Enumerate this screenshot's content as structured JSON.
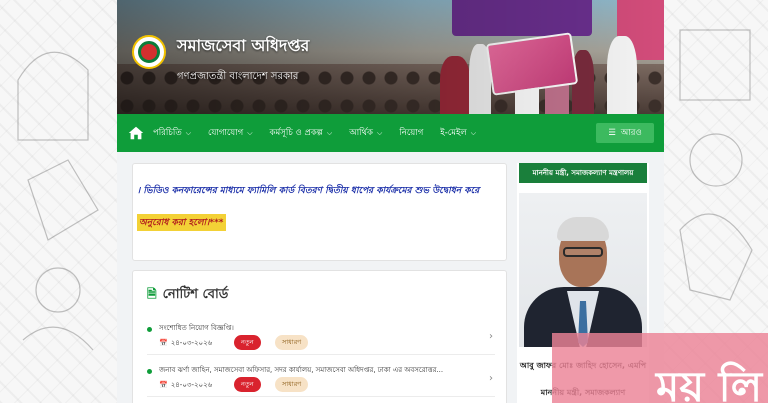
{
  "header": {
    "site_title": "সমাজসেবা অধিদপ্তর",
    "site_subtitle": "গণপ্রজাতন্ত্রী বাংলাদেশ সরকার"
  },
  "nav": {
    "items": [
      {
        "label": "পরিচিতি",
        "has_dropdown": true
      },
      {
        "label": "যোগাযোগ",
        "has_dropdown": true
      },
      {
        "label": "কর্মসূচি ও প্রকল্প",
        "has_dropdown": true
      },
      {
        "label": "আর্থিক",
        "has_dropdown": true
      },
      {
        "label": "নিয়োগ",
        "has_dropdown": false
      },
      {
        "label": "ই-মেইল",
        "has_dropdown": true
      }
    ],
    "more_label": "আরও",
    "accent_color": "#0f9d3a"
  },
  "marquee": {
    "headline": "। ভিডিও কনফারেন্সের মাধ্যমে ফ্যামিলি কার্ড বিতরণ দ্বিতীয় ধাপের কার্যক্রমের শুভ উদ্বোধন করে",
    "notice": "অনুরোধ করা হলো।***"
  },
  "notice_board": {
    "title": "নোটিশ বোর্ড",
    "items": [
      {
        "text": "সংশোধিত নিয়োগ বিজ্ঞপ্তি।",
        "date": "২৪-০৩-২০২৬",
        "badge_new": "নতুন",
        "badge_type": "সাধারণ"
      },
      {
        "text": "জনাব ঝর্ণা জাহিন, সমাজসেবা অফিসার, সদর কার্যালয়, সমাজসেবা অধিদপ্তর, ঢাকা এর অবসরোত্তর...",
        "date": "২৪-০৩-২০২৬",
        "badge_new": "নতুন",
        "badge_type": "সাধারণ"
      }
    ]
  },
  "minister": {
    "header": "মাননীয় মন্ত্রী, সমাজকল্যাণ মন্ত্রণালয়",
    "name": "আবু জাফর মোঃ জাহিদ হোসেন, এমপি",
    "role": "মাননীয় মন্ত্রী, সমাজকল্যাণ"
  },
  "watermark": {
    "text": "ময় লি"
  }
}
